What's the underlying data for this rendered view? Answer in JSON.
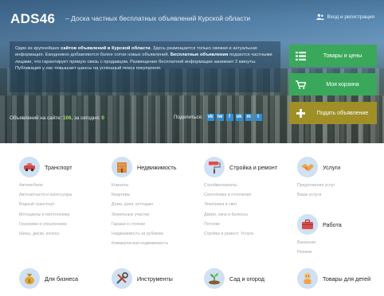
{
  "header": {
    "logo": "ADS46",
    "tagline": "–  Доска частных бесплатных объявлений Курской области",
    "login_label": "Вход и регистрация"
  },
  "intro": {
    "p1": "Один из крупнейших ",
    "b1": "сайтов объявлений в Курской области",
    "p2": ". Здесь размещается только свежая и актуальная информация. Ежедневно добавляются более сотни новых объявлений. ",
    "b2": "Бесплатные объявления",
    "p3": " подаются частными лицами, что гарантирует прямую связь с продавцом. Размещение бесплатной информации занимает 2 минуты. Публикация у нас повышает шансы на успешный поиск покупателя."
  },
  "stats": {
    "label": "Объявлений на сайте:",
    "total": "106",
    "today_label": ", за сегодня:",
    "today": "0"
  },
  "share": {
    "label": "Поделиться:",
    "buttons": [
      "vk",
      "tw",
      "f",
      "ok",
      "m",
      "t"
    ]
  },
  "cta": {
    "goods": "Товары и цены",
    "cart": "Моя корзина",
    "post": "Подать объявление"
  },
  "categories": [
    {
      "title": "Транспорт",
      "icon": "car-icon",
      "items": [
        "Автомобили",
        "Автозапчасти и аксессуары",
        "Водный транспорт",
        "Мотоциклы и мототехника",
        "Грузовики и спецтехника",
        "Шины, диски, колеса"
      ]
    },
    {
      "title": "Недвижимость",
      "icon": "building-icon",
      "items": [
        "Комнаты",
        "Квартиры",
        "Дома, дачи, коттеджи",
        "Земельные участки",
        "Гаражи и стоянки",
        "Недвижимость за рубежом",
        "Коммерческая недвижимость"
      ]
    },
    {
      "title": "Стройка и ремонт",
      "icon": "paint-roller-icon",
      "items": [
        "Стройматериалы",
        "Сантехника и отопление",
        "Электрика и свет",
        "Двери, окна и балконы",
        "Потолки",
        "Стройка и ремонт: Услуги"
      ]
    },
    {
      "title": "Услуги",
      "icon": "handshake-icon",
      "items": [
        "Предложение услуг",
        "Ваши услуги"
      ]
    },
    {
      "title": "Работа",
      "icon": "briefcase-icon",
      "items": [
        "Вакансии",
        "Резюме"
      ]
    },
    {
      "title": "Для бизнеса",
      "icon": "money-bag-icon",
      "items": []
    },
    {
      "title": "Инструменты",
      "icon": "tools-icon",
      "items": []
    },
    {
      "title": "Сад и огород",
      "icon": "sprout-icon",
      "items": []
    },
    {
      "title": "Товары для детей",
      "icon": "baby-icon",
      "items": []
    }
  ],
  "colors": {
    "cta_green": "#3aa85a",
    "cta_olive": "#9f8f26",
    "share_blue": "#2f8ed1",
    "stat_number": "#a6e35b",
    "icon_bg": "#cfe1f3"
  }
}
